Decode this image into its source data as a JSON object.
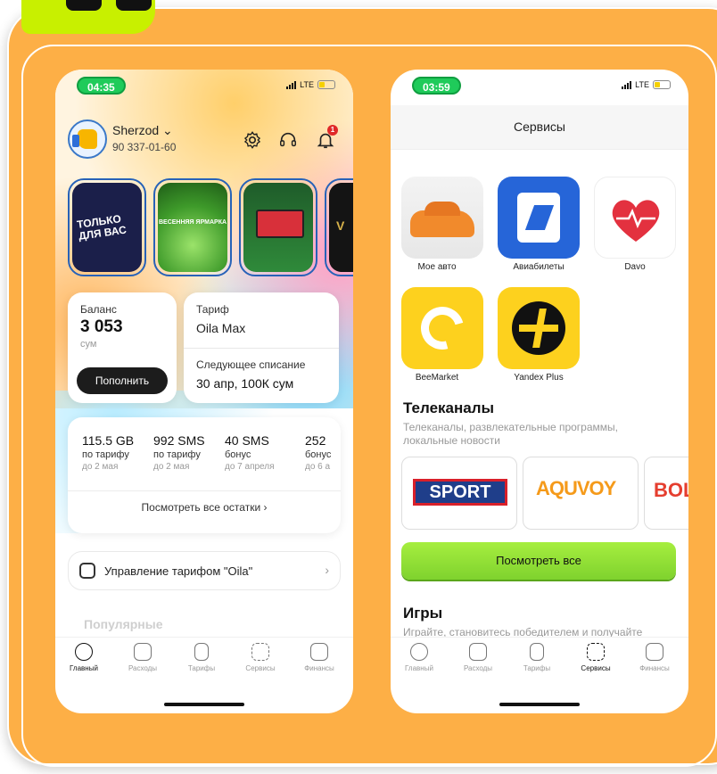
{
  "phone1": {
    "status_time": "04:35",
    "network": "LTE",
    "user": {
      "name": "Sherzod ⌄",
      "phone": "90 337-01-60"
    },
    "notification_count": "1",
    "stories": [
      {
        "text": "ТОЛЬКО ДЛЯ ВАС"
      },
      {
        "text": "ВЕСЕННЯЯ ЯРМАРКА"
      },
      {
        "text": ""
      },
      {
        "text": "V"
      }
    ],
    "balance": {
      "label": "Баланс",
      "value": "3 053",
      "unit": "сум",
      "topup_label": "Пополнить"
    },
    "tariff": {
      "label": "Тариф",
      "value": "Oila Max",
      "next_label": "Следующее списание",
      "next_value": "30 апр, 100К сум"
    },
    "remains": [
      {
        "value": "115.5 GB",
        "sub": "по тарифу",
        "date": "до 2 мая"
      },
      {
        "value": "992 SMS",
        "sub": "по тарифу",
        "date": "до 2 мая"
      },
      {
        "value": "40 SMS",
        "sub": "бонус",
        "date": "до 7 апреля"
      },
      {
        "value": "252",
        "sub": "бонус",
        "date": "до 6 а"
      }
    ],
    "remains_link": "Посмотреть все остатки ›",
    "manage_label": "Управление тарифом \"Oila\"",
    "popular_title": "Популярные",
    "tabs": [
      {
        "label": "Главный",
        "active": true
      },
      {
        "label": "Расходы",
        "active": false
      },
      {
        "label": "Тарифы",
        "active": false
      },
      {
        "label": "Сервисы",
        "active": false
      },
      {
        "label": "Финансы",
        "active": false
      }
    ]
  },
  "phone2": {
    "status_time": "03:59",
    "network": "LTE",
    "title": "Сервисы",
    "apps": [
      {
        "label": "Мое авто",
        "icon": "car-icon"
      },
      {
        "label": "Авиабилеты",
        "icon": "kiwi-icon"
      },
      {
        "label": "Davo",
        "icon": "heart-pulse-icon"
      },
      {
        "label": "BeeMarket",
        "icon": "beemarket-icon"
      },
      {
        "label": "Yandex Plus",
        "icon": "yandex-plus-icon"
      }
    ],
    "tv_title": "Телеканалы",
    "tv_subtitle": "Телеканалы, развлекательные программы, локальные новости",
    "channels": [
      "SPORT",
      "AQUVOY",
      "BOL"
    ],
    "see_all_label": "Посмотреть все",
    "games_title": "Игры",
    "games_subtitle": "Играйте, становитесь победителем и получайте",
    "tabs": [
      {
        "label": "Главный",
        "active": false
      },
      {
        "label": "Расходы",
        "active": false
      },
      {
        "label": "Тарифы",
        "active": false
      },
      {
        "label": "Сервисы",
        "active": true
      },
      {
        "label": "Финансы",
        "active": false
      }
    ]
  },
  "colors": {
    "frame": "#fdaf46",
    "badge": "#c8f000",
    "status_pill": "#1fcb5a",
    "button_green": "#8fdc32",
    "accent_blue": "#2665d8"
  }
}
